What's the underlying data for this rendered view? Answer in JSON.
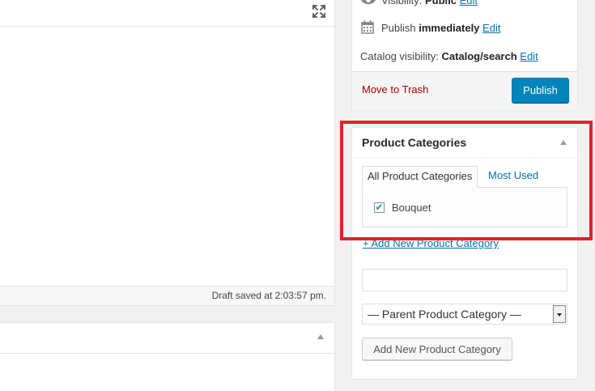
{
  "editor": {
    "draft_status": "Draft saved at 2:03:57 pm."
  },
  "publish": {
    "visibility_label": "Visibility:",
    "visibility_value": "Public",
    "visibility_edit": "Edit",
    "publish_label": "Publish",
    "publish_value": "immediately",
    "publish_edit": "Edit",
    "catalog_label": "Catalog visibility:",
    "catalog_value": "Catalog/search",
    "catalog_edit": "Edit",
    "trash_label": "Move to Trash",
    "publish_button": "Publish"
  },
  "categories": {
    "title": "Product Categories",
    "tab_all": "All Product Categories",
    "tab_most_used": "Most Used",
    "items": [
      {
        "label": "Bouquet",
        "checked": true
      }
    ],
    "add_new_link": "+ Add New Product Category",
    "new_category_input_value": "",
    "parent_select_value": "— Parent Product Category —",
    "add_button": "Add New Product Category"
  },
  "colors": {
    "link": "#0073aa",
    "publish_button": "#0085ba",
    "trash": "#aa0000",
    "highlight": "#e0242b"
  },
  "icons": {
    "fullscreen": "fullscreen-icon",
    "visibility": "eye-icon",
    "schedule": "calendar-icon"
  }
}
